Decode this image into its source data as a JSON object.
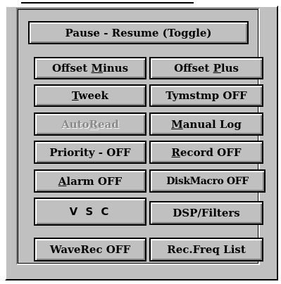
{
  "buttons": {
    "pause_resume": {
      "label": "Pause - Resume (Toggle)"
    },
    "offset_minus": {
      "pre": "Offset ",
      "ul": "M",
      "post": "inus"
    },
    "offset_plus": {
      "pre": "Offset ",
      "ul": "P",
      "post": "lus"
    },
    "tweek": {
      "pre": "",
      "ul": "T",
      "post": "week"
    },
    "tymstmp": {
      "label": "Tymstmp OFF"
    },
    "autoread": {
      "pre": "Auto",
      "ul": "R",
      "post": "ead"
    },
    "manual_log": {
      "pre": "",
      "ul": "M",
      "post": "anual Log"
    },
    "priority": {
      "label": "Priority - OFF"
    },
    "record": {
      "pre": "",
      "ul": "R",
      "post": "ecord OFF"
    },
    "alarm": {
      "pre": "",
      "ul": "A",
      "post": "larm OFF"
    },
    "diskmacro": {
      "label": "DiskMacro OFF"
    },
    "vsc": {
      "label": "V S C"
    },
    "dsp_filters": {
      "label": "DSP/Filters"
    },
    "waverec": {
      "label": "WaveRec OFF"
    },
    "rec_freq_list": {
      "label": "Rec.Freq List"
    }
  }
}
